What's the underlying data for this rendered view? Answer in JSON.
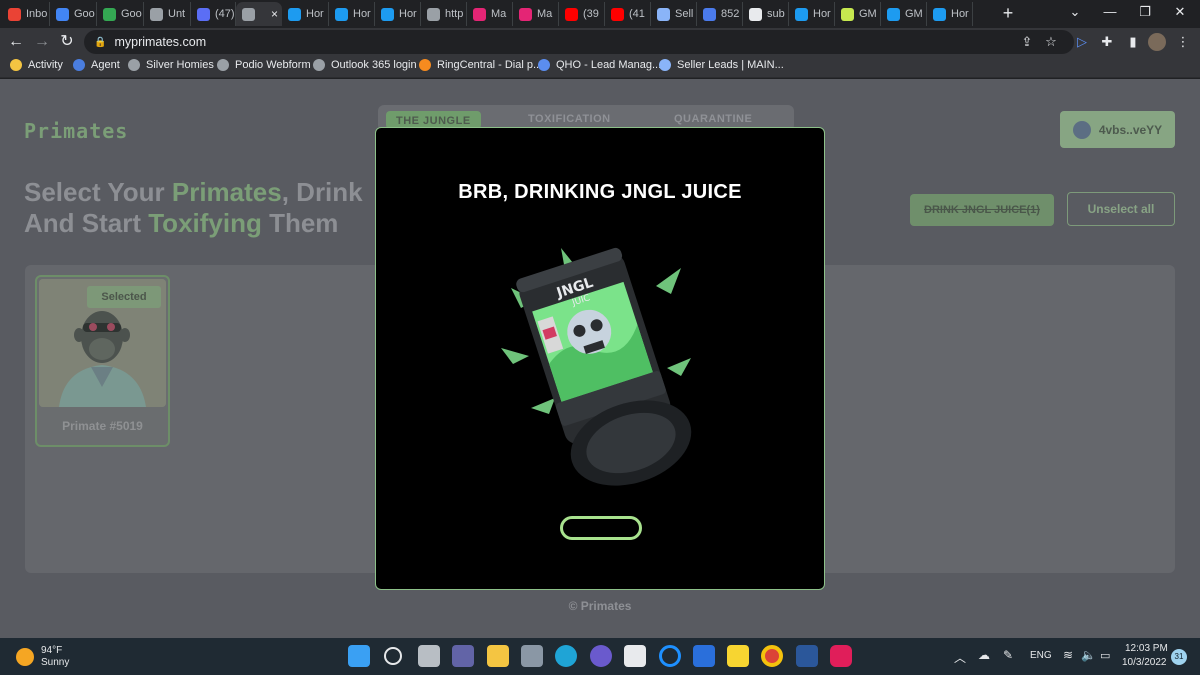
{
  "browser": {
    "tabs": [
      {
        "label": "Inbo",
        "favicon": "gmail-icon",
        "color": "#ea4335"
      },
      {
        "label": "Goo",
        "favicon": "calendar-icon",
        "color": "#4285f4"
      },
      {
        "label": "Goo",
        "favicon": "google-icon",
        "color": "#34a853"
      },
      {
        "label": "Unt",
        "favicon": "globe-icon",
        "color": "#9aa0a6"
      },
      {
        "label": "(47)",
        "favicon": "chat-icon",
        "color": "#5b6ef5"
      },
      {
        "label": "",
        "favicon": "globe-icon",
        "color": "#9aa0a6",
        "active": true
      },
      {
        "label": "Hor",
        "favicon": "twitter-icon",
        "color": "#1d9bf0"
      },
      {
        "label": "Hor",
        "favicon": "twitter-icon",
        "color": "#1d9bf0"
      },
      {
        "label": "Hor",
        "favicon": "twitter-icon",
        "color": "#1d9bf0"
      },
      {
        "label": "http",
        "favicon": "globe-icon",
        "color": "#9aa0a6"
      },
      {
        "label": "Ma",
        "favicon": "magic-eden-icon",
        "color": "#e42575"
      },
      {
        "label": "Ma",
        "favicon": "magic-eden-icon",
        "color": "#e42575"
      },
      {
        "label": "(39",
        "favicon": "youtube-icon",
        "color": "#ff0000"
      },
      {
        "label": "(41",
        "favicon": "youtube-icon",
        "color": "#ff0000"
      },
      {
        "label": "Sell",
        "favicon": "seller-icon",
        "color": "#8ab4f8"
      },
      {
        "label": "852",
        "favicon": "zillow-icon",
        "color": "#4b7bec"
      },
      {
        "label": "sub",
        "favicon": "peace-icon",
        "color": "#e8eaed"
      },
      {
        "label": "Hor",
        "favicon": "twitter-icon",
        "color": "#1d9bf0"
      },
      {
        "label": "GM",
        "favicon": "sun-icon",
        "color": "#c6e84f"
      },
      {
        "label": "GM",
        "favicon": "twitter-icon",
        "color": "#1d9bf0"
      },
      {
        "label": "Hor",
        "favicon": "twitter-icon",
        "color": "#1d9bf0"
      }
    ],
    "tab_close": "×",
    "new_tab": "+",
    "url": "myprimates.com",
    "bookmarks": [
      {
        "label": "Activity",
        "icon": "activity-icon",
        "color": "#f4c542"
      },
      {
        "label": "Agent",
        "icon": "agent-icon",
        "color": "#4a7dde"
      },
      {
        "label": "Silver Homies",
        "icon": "silver-homies-icon",
        "color": "#9aa0a6"
      },
      {
        "label": "Podio Webform",
        "icon": "globe-icon",
        "color": "#9aa0a6"
      },
      {
        "label": "Outlook 365 login",
        "icon": "outlook-icon",
        "color": "#9aa0a6"
      },
      {
        "label": "RingCentral - Dial p...",
        "icon": "ringcentral-icon",
        "color": "#f68b1f"
      },
      {
        "label": "QHO - Lead Manag...",
        "icon": "forms-icon",
        "color": "#5b8def"
      },
      {
        "label": "Seller Leads | MAIN...",
        "icon": "seller-icon",
        "color": "#8ab4f8"
      }
    ]
  },
  "page": {
    "logo": "Primates",
    "tabs": [
      "THE JUNGLE",
      "TOXIFICATION",
      "QUARANTINE"
    ],
    "wallet": "4vbs..veYY",
    "headline": {
      "part1": "Select Your ",
      "hl1": "Primates",
      "part2": ", Drink",
      "part3": "And Start ",
      "hl2": "Toxifying",
      "part4": " Them"
    },
    "drink_button": "DRINK JNGL JUICE(1)",
    "unselect_button": "Unselect all",
    "card": {
      "badge": "Selected",
      "name": "Primate #5019"
    },
    "footer": "© Primates"
  },
  "modal": {
    "title": "BRB, DRINKING JNGL JUICE",
    "can_text_1": "JNGL",
    "can_text_2": "JUIC"
  },
  "taskbar": {
    "weather_temp": "94°F",
    "weather_desc": "Sunny",
    "lang": "ENG",
    "time": "12:03 PM",
    "date": "10/3/2022",
    "notif_count": "31"
  },
  "colors": {
    "accent_green": "#8dc189",
    "button_green": "#a8e28e"
  }
}
